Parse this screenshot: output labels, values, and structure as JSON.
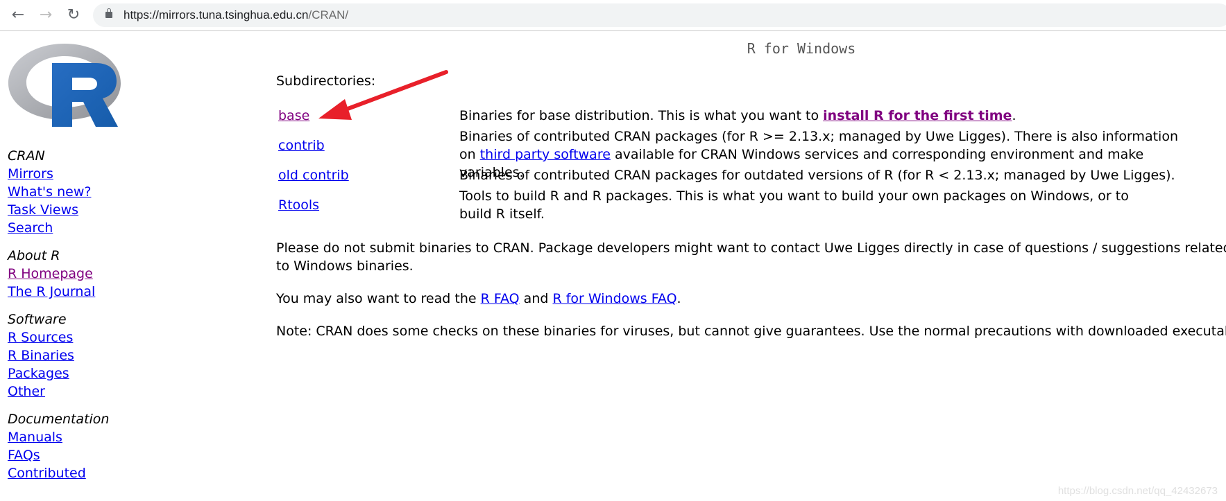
{
  "browser": {
    "url_host": "https://mirrors.tuna.tsinghua.edu.cn",
    "url_path": "/CRAN/",
    "back": "←",
    "forward": "→",
    "reload": "↻"
  },
  "logo": {
    "letter": "R"
  },
  "sidebar": {
    "sections": [
      {
        "heading": "CRAN",
        "links": [
          "Mirrors",
          "What's new?",
          "Task Views",
          "Search"
        ]
      },
      {
        "heading": "About R",
        "links": [
          "R Homepage",
          "The R Journal"
        ]
      },
      {
        "heading": "Software",
        "links": [
          "R Sources",
          "R Binaries",
          "Packages",
          "Other"
        ]
      },
      {
        "heading": "Documentation",
        "links": [
          "Manuals",
          "FAQs",
          "Contributed"
        ]
      }
    ]
  },
  "page": {
    "title": "R for Windows",
    "subdirectories_label": "Subdirectories:",
    "rows": [
      {
        "link": "base",
        "desc_pre": "Binaries for base distribution. This is what you want to ",
        "desc_link": "install R for the first time",
        "desc_post": "."
      },
      {
        "link": "contrib",
        "desc_pre": "Binaries of contributed CRAN packages (for R >= 2.13.x; managed by Uwe Ligges). There is also information on ",
        "desc_link": "third party software",
        "desc_post": " available for CRAN Windows services and corresponding environment and make variables."
      },
      {
        "link": "old contrib",
        "desc_pre": "Binaries of contributed CRAN packages for outdated versions of R (for R < 2.13.x; managed by Uwe Ligges)."
      },
      {
        "link": "Rtools",
        "desc_pre": "Tools to build R and R packages. This is what you want to build your own packages on Windows, or to build R itself."
      }
    ],
    "para1": "Please do not submit binaries to CRAN. Package developers might want to contact Uwe Ligges directly in case of questions / suggestions related to Windows binaries.",
    "para2_pre": "You may also want to read the ",
    "para2_link1": "R FAQ",
    "para2_mid": " and ",
    "para2_link2": "R for Windows FAQ",
    "para2_post": ".",
    "para3": "Note: CRAN does some checks on these binaries for viruses, but cannot give guarantees. Use the normal precautions with downloaded executables."
  },
  "annotation": {
    "arrow_color": "#e8202a"
  },
  "watermark": "https://blog.csdn.net/qq_42432673"
}
